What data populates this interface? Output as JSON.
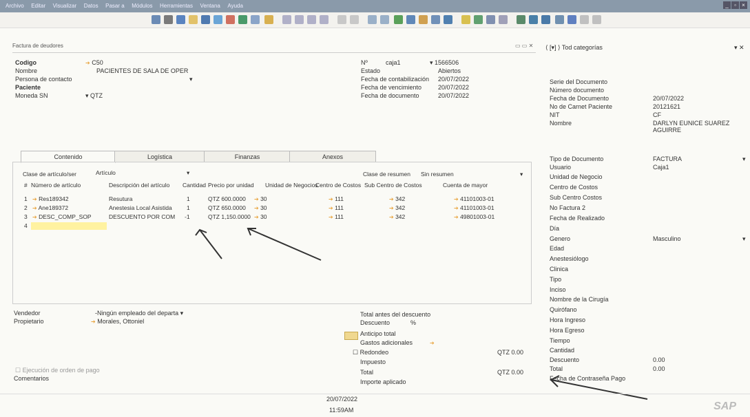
{
  "menu": [
    "Archivo",
    "Editar",
    "Visualizar",
    "Datos",
    "Pasar a",
    "Módulos",
    "Herramientas",
    "Ventana",
    "Ayuda"
  ],
  "window": {
    "title": "Factura de deudores"
  },
  "header": {
    "codigo_label": "Codigo",
    "codigo_value": "C50",
    "nombre_label": "Nombre",
    "nombre_value": "PACIENTES DE SALA DE OPER",
    "contacto_label": "Persona de contacto",
    "paciente_label": "Paciente",
    "moneda_label": "Moneda SN",
    "moneda_value": "QTZ",
    "no_label": "Nº",
    "no_series": "caja1",
    "no_value": "1566506",
    "estado_label": "Estado",
    "estado_value": "Abiertos",
    "fecha_cont_label": "Fecha de contabilización",
    "fecha_cont_value": "20/07/2022",
    "fecha_venc_label": "Fecha de vencimiento",
    "fecha_venc_value": "20/07/2022",
    "fecha_doc_label": "Fecha de documento",
    "fecha_doc_value": "20/07/2022"
  },
  "tabs": [
    "Contenido",
    "Logística",
    "Finanzas",
    "Anexos"
  ],
  "grid": {
    "clase_articulo_label": "Clase de artículo/ser",
    "clase_articulo_value": "Artículo",
    "clase_resumen_label": "Clase de resumen",
    "clase_resumen_value": "Sin resumen",
    "columns": [
      "#",
      "Número de artículo",
      "Descripción del artículo",
      "Cantidad",
      "Precio por unidad",
      "Unidad de Negocios",
      "Centro de Costos",
      "Sub Centro de Costos",
      "Cuenta de mayor"
    ],
    "rows": [
      {
        "n": "1",
        "art": "Res189342",
        "desc": "Resutura",
        "qty": "1",
        "price": "QTZ 600.0000",
        "un": "30",
        "cc": "111",
        "scc": "342",
        "cta": "41101003-01"
      },
      {
        "n": "2",
        "art": "Ane189372",
        "desc": "Anestesia Local Asistida",
        "qty": "1",
        "price": "QTZ 650.0000",
        "un": "30",
        "cc": "111",
        "scc": "342",
        "cta": "41101003-01"
      },
      {
        "n": "3",
        "art": "DESC_COMP_SOP",
        "desc": "DESCUENTO POR COM",
        "qty": "-1",
        "price": "QTZ 1,150.0000",
        "un": "30",
        "cc": "111",
        "scc": "342",
        "cta": "49801003-01"
      },
      {
        "n": "4",
        "art": "",
        "desc": "",
        "qty": "",
        "price": "",
        "un": "",
        "cc": "",
        "scc": "",
        "cta": ""
      }
    ]
  },
  "footer": {
    "vendedor_label": "Vendedor",
    "vendedor_value": "-Ningún empleado del departa",
    "propietario_label": "Propietario",
    "propietario_value": "Morales, Ottoniel",
    "ejecucion_label": "Ejecución de orden de pago",
    "comentarios_label": "Comentarios",
    "total_antes_label": "Total antes del descuento",
    "descuento_label": "Descuento",
    "descuento_pct": "%",
    "anticipo_label": "Anticipo total",
    "gastos_label": "Gastos adicionales",
    "redondeo_label": "Redondeo",
    "redondeo_value": "QTZ 0.00",
    "impuesto_label": "Impuesto",
    "total_label": "Total",
    "total_value": "QTZ 0.00",
    "importe_label": "Importe aplicado"
  },
  "side": {
    "category": "Tod categorías",
    "fields": [
      {
        "label": "Serie del Documento",
        "value": ""
      },
      {
        "label": "Número documento",
        "value": ""
      },
      {
        "label": "Fecha de Documento",
        "value": "20/07/2022"
      },
      {
        "label": "No de Carnet Paciente",
        "value": "20121621"
      },
      {
        "label": "NIT",
        "value": "CF"
      },
      {
        "label": "Nombre",
        "value": "DARLYN EUNICE SUAREZ AGUIRRE"
      }
    ],
    "fields2": [
      {
        "label": "Tipo de Documento",
        "value": "FACTURA"
      },
      {
        "label": "Usuario",
        "value": "Caja1"
      },
      {
        "label": "Unidad de Negocio",
        "value": ""
      },
      {
        "label": "Centro de Costos",
        "value": ""
      },
      {
        "label": "Sub Centro Costos",
        "value": ""
      },
      {
        "label": "No Factura 2",
        "value": ""
      },
      {
        "label": "Fecha de Realizado",
        "value": ""
      },
      {
        "label": "Día",
        "value": ""
      },
      {
        "label": "Genero",
        "value": "Masculino"
      },
      {
        "label": "Edad",
        "value": ""
      },
      {
        "label": "Anestesiólogo",
        "value": ""
      },
      {
        "label": "Clinica",
        "value": ""
      },
      {
        "label": "Tipo",
        "value": ""
      },
      {
        "label": "Inciso",
        "value": ""
      },
      {
        "label": "Nombre de la Cirugía",
        "value": ""
      },
      {
        "label": "Quirófano",
        "value": ""
      },
      {
        "label": "Hora Ingreso",
        "value": ""
      },
      {
        "label": "Hora Egreso",
        "value": ""
      },
      {
        "label": "Tiempo",
        "value": ""
      },
      {
        "label": "Cantidad",
        "value": ""
      },
      {
        "label": "Descuento",
        "value": "0.00"
      },
      {
        "label": "Total",
        "value": "0.00"
      },
      {
        "label": "Fecha de Contraseña Pago",
        "value": ""
      }
    ]
  },
  "status": {
    "date": "20/07/2022",
    "time": "11:59AM"
  },
  "brand": "SAP"
}
